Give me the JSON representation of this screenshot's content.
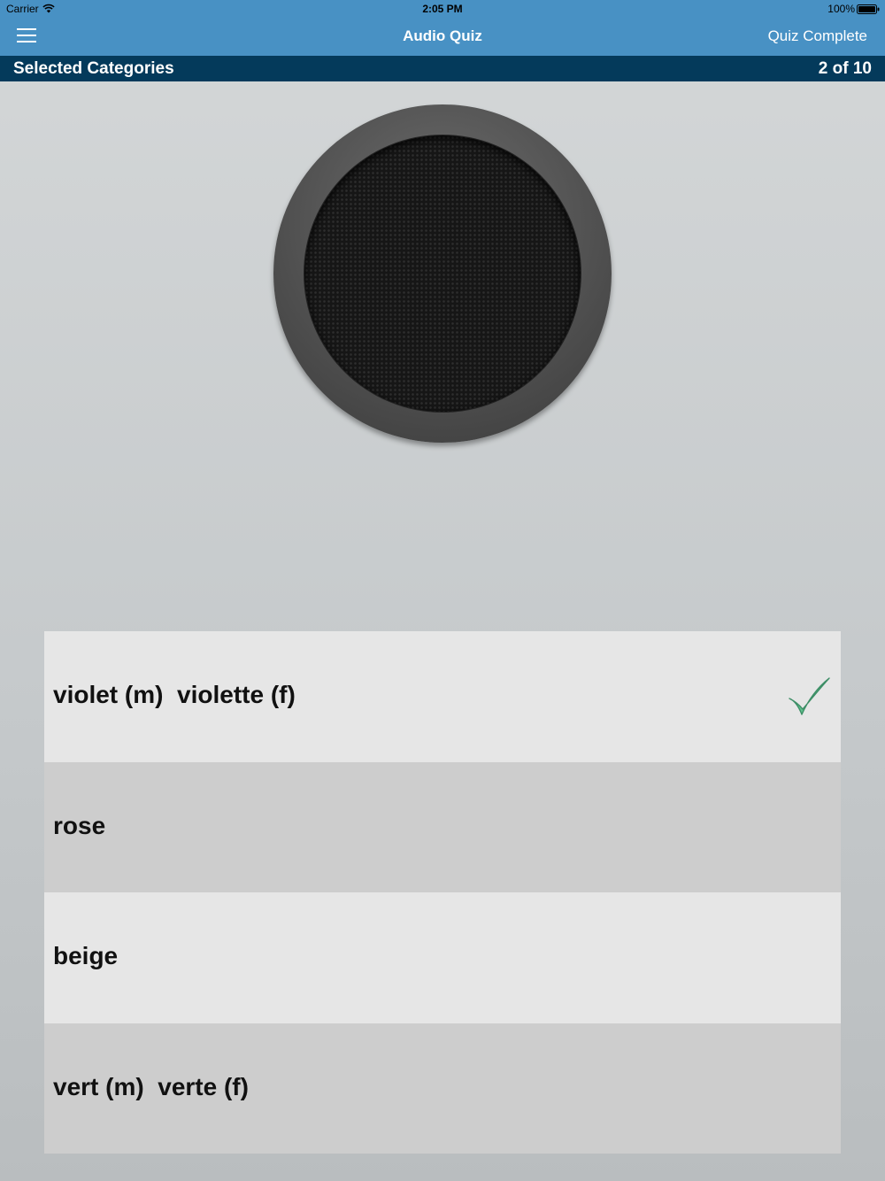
{
  "status": {
    "carrier": "Carrier",
    "time": "2:05 PM",
    "battery": "100%"
  },
  "nav": {
    "title": "Audio Quiz",
    "right_label": "Quiz Complete"
  },
  "subheader": {
    "left": "Selected Categories",
    "right": "2 of 10"
  },
  "colors": {
    "nav_bg": "#4891c4",
    "subheader_bg": "#043a5b",
    "check": "#5fc18d"
  },
  "icons": {
    "menu": "hamburger-icon",
    "speaker": "speaker-icon",
    "check": "checkmark-icon"
  },
  "answers": [
    {
      "label": "violet (m)  violette (f)",
      "correct": true
    },
    {
      "label": "rose",
      "correct": false
    },
    {
      "label": "beige",
      "correct": false
    },
    {
      "label": "vert (m)  verte (f)",
      "correct": false
    }
  ]
}
